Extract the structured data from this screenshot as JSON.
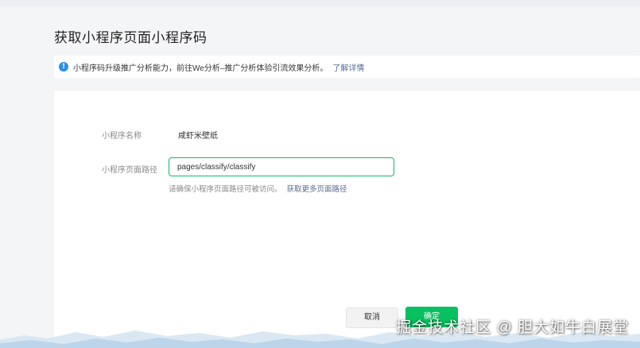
{
  "page": {
    "title": "获取小程序页面小程序码"
  },
  "notice": {
    "icon": "info-icon",
    "icon_glyph": "!",
    "text": "小程序码升级推广分析能力，前往We分析–推广分析体验引流效果分析。",
    "link": "了解详情"
  },
  "form": {
    "name_label": "小程序名称",
    "name_value": "咸虾米壁纸",
    "path_label": "小程序页面路径",
    "path_value": "pages/classify/classify",
    "hint_text": "请确保小程序页面路径可被访问。",
    "hint_link": "获取更多页面路径"
  },
  "actions": {
    "cancel_label": "取消",
    "ok_label": "确定"
  },
  "watermark": {
    "text": "掘金技术社区 @ 胆大如牛白展堂"
  },
  "colors": {
    "accent": "#07c160",
    "link": "#576b95",
    "info": "#2b8ef3"
  }
}
